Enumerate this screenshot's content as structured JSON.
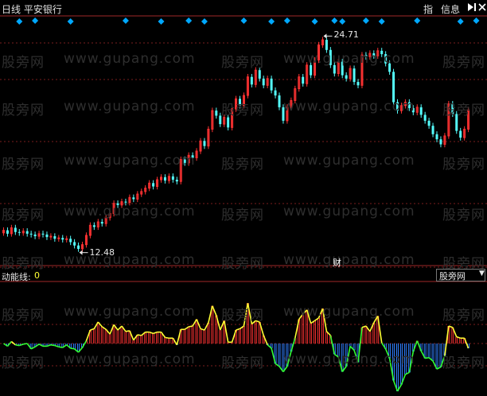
{
  "window": {
    "title": "日线  平安银行",
    "toolbar": {
      "zhi_label": "指",
      "info_label": "信息",
      "jump_icon": "jump-to-end-icon",
      "close_icon": "close-icon"
    }
  },
  "price_panel": {
    "high_label": "24.71",
    "low_label": "12.48",
    "caiwu_label": "财",
    "colors": {
      "up": "#ff3232",
      "down": "#54fcfc",
      "grid": "#7a1e1e",
      "diamond": "#00a8ff"
    }
  },
  "indicator_panel": {
    "label": "动能线:",
    "value": "0",
    "select_value": "股旁网",
    "colors": {
      "pos": "#ff3232",
      "neg": "#2f7fff",
      "line_pos": "#ffff33",
      "line_neg": "#33ff33"
    }
  },
  "watermark": {
    "cn": "股旁网",
    "url": "www.gupang.com"
  },
  "chart_data": {
    "type": "candlestick",
    "high": 24.71,
    "low": 12.48,
    "bars": [
      [
        0.3,
        0.6
      ],
      [
        0.6,
        0.2
      ],
      [
        0.2,
        0.9
      ],
      [
        0.9,
        0.4
      ],
      [
        0.4,
        0.3
      ],
      [
        0.3,
        0.5
      ],
      [
        0.5,
        0.2
      ],
      [
        0.2,
        0.1
      ],
      [
        0.1,
        -0.1
      ],
      [
        -0.1,
        0.2
      ],
      [
        0.2,
        0.1
      ],
      [
        0.1,
        -0.2
      ],
      [
        -0.2,
        -0.1
      ],
      [
        -0.1,
        -0.4
      ],
      [
        -0.4,
        -0.3
      ],
      [
        -0.3,
        -0.5
      ],
      [
        -0.5,
        -0.4
      ],
      [
        -0.4,
        -0.8
      ],
      [
        -0.8,
        -1.2
      ],
      [
        -1.2,
        -1.6
      ],
      [
        -1.6,
        -1.1
      ],
      [
        -1.1,
        0.0
      ],
      [
        0.0,
        1.2
      ],
      [
        1.2,
        1.0
      ],
      [
        1.0,
        1.6
      ],
      [
        1.6,
        1.4
      ],
      [
        1.4,
        2.1
      ],
      [
        2.1,
        2.6
      ],
      [
        2.6,
        3.8
      ],
      [
        3.8,
        3.6
      ],
      [
        3.6,
        4.0
      ],
      [
        4.0,
        3.9
      ],
      [
        3.9,
        4.5
      ],
      [
        4.5,
        4.3
      ],
      [
        4.3,
        4.9
      ],
      [
        4.9,
        5.2
      ],
      [
        5.2,
        5.6
      ],
      [
        5.6,
        6.2
      ],
      [
        6.2,
        5.8
      ],
      [
        5.8,
        6.6
      ],
      [
        6.6,
        6.9
      ],
      [
        6.9,
        6.5
      ],
      [
        6.5,
        7.0
      ],
      [
        7.0,
        6.6
      ],
      [
        6.6,
        6.4
      ],
      [
        6.4,
        9.0
      ],
      [
        9.0,
        8.6
      ],
      [
        8.6,
        9.5
      ],
      [
        9.5,
        9.2
      ],
      [
        9.2,
        10.0
      ],
      [
        10.0,
        11.2
      ],
      [
        11.2,
        10.6
      ],
      [
        10.6,
        12.6
      ],
      [
        12.6,
        14.8
      ],
      [
        14.8,
        14.2
      ],
      [
        14.2,
        13.2
      ],
      [
        13.2,
        14.0
      ],
      [
        14.0,
        12.8
      ],
      [
        12.8,
        15.0
      ],
      [
        15.0,
        16.2
      ],
      [
        16.2,
        15.4
      ],
      [
        15.4,
        16.6
      ],
      [
        16.6,
        18.8
      ],
      [
        18.8,
        17.9
      ],
      [
        17.9,
        19.6
      ],
      [
        19.6,
        18.6
      ],
      [
        18.6,
        17.8
      ],
      [
        17.8,
        18.6
      ],
      [
        18.6,
        17.2
      ],
      [
        17.2,
        16.6
      ],
      [
        16.6,
        15.2
      ],
      [
        15.2,
        13.6
      ],
      [
        13.6,
        15.2
      ],
      [
        15.2,
        16.0
      ],
      [
        16.0,
        17.4
      ],
      [
        17.4,
        18.8
      ],
      [
        18.8,
        18.0
      ],
      [
        18.0,
        20.2
      ],
      [
        20.2,
        19.0
      ],
      [
        19.0,
        20.8
      ],
      [
        20.8,
        22.6
      ],
      [
        22.6,
        23.2
      ],
      [
        23.2,
        22.0
      ],
      [
        22.0,
        20.2
      ],
      [
        20.2,
        19.2
      ],
      [
        19.2,
        20.6
      ],
      [
        20.6,
        19.0
      ],
      [
        19.0,
        18.6
      ],
      [
        18.6,
        19.8
      ],
      [
        19.8,
        18.2
      ],
      [
        18.2,
        17.8
      ],
      [
        17.8,
        21.4
      ],
      [
        21.4,
        21.2
      ],
      [
        21.2,
        21.6
      ],
      [
        21.6,
        21.3
      ],
      [
        21.3,
        21.9
      ],
      [
        21.9,
        21.5
      ],
      [
        21.5,
        20.4
      ],
      [
        20.4,
        19.4
      ],
      [
        19.4,
        15.8
      ],
      [
        15.8,
        14.8
      ],
      [
        14.8,
        15.4
      ],
      [
        15.4,
        15.8
      ],
      [
        15.8,
        15.1
      ],
      [
        15.1,
        14.6
      ],
      [
        14.6,
        15.2
      ],
      [
        15.2,
        14.3
      ],
      [
        14.3,
        13.6
      ],
      [
        13.6,
        13.0
      ],
      [
        13.0,
        12.0
      ],
      [
        12.0,
        11.4
      ],
      [
        11.4,
        10.8
      ],
      [
        10.8,
        11.8
      ],
      [
        11.8,
        15.6
      ],
      [
        15.6,
        14.4
      ],
      [
        14.4,
        12.4
      ],
      [
        12.4,
        11.6
      ],
      [
        11.6,
        12.6
      ],
      [
        12.6,
        14.9
      ]
    ],
    "diamonds": [
      4,
      8,
      17,
      31,
      40,
      47,
      51,
      61,
      68,
      72,
      79,
      84,
      86,
      92,
      96,
      105,
      116,
      120
    ]
  }
}
